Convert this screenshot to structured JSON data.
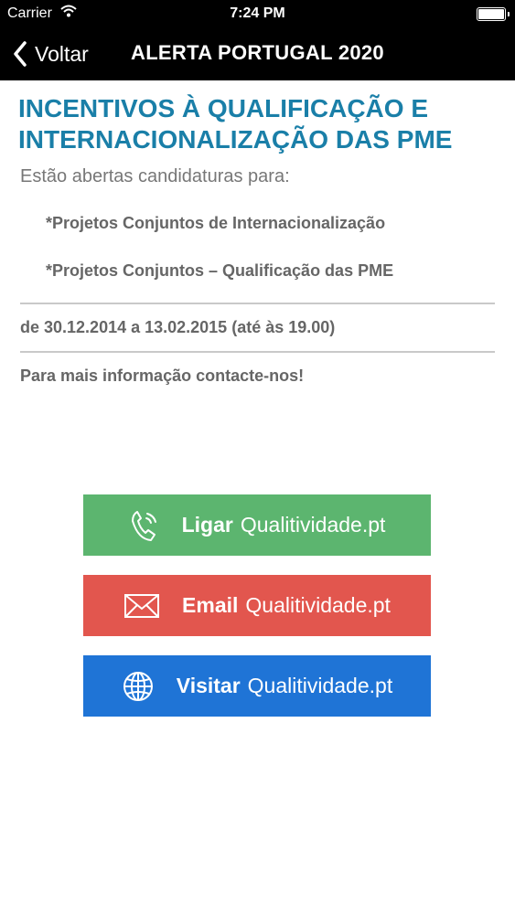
{
  "status_bar": {
    "carrier": "Carrier",
    "time": "7:24 PM"
  },
  "nav": {
    "back_label": "Voltar",
    "title": "ALERTA PORTUGAL 2020"
  },
  "article": {
    "headline_line1": "INCENTIVOS À QUALIFICAÇÃO E",
    "headline_line2": "INTERNACIONALIZAÇÃO DAS PME",
    "intro": "Estão abertas candidaturas para:",
    "items": [
      "*Projetos Conjuntos de Internacionalização",
      "*Projetos Conjuntos – Qualificação das PME"
    ],
    "dates": "de 30.12.2014 a 13.02.2015 (até às 19.00)",
    "info": "Para mais informação contacte-nos!"
  },
  "buttons": {
    "call": {
      "verb": "Ligar",
      "target": "Qualitividade.pt",
      "icon": "phone-icon",
      "color": "#5cb56f"
    },
    "email": {
      "verb": "Email",
      "target": "Qualitividade.pt",
      "icon": "envelope-icon",
      "color": "#e2564e"
    },
    "visit": {
      "verb": "Visitar",
      "target": "Qualitividade.pt",
      "icon": "globe-icon",
      "color": "#1f74d6"
    }
  }
}
